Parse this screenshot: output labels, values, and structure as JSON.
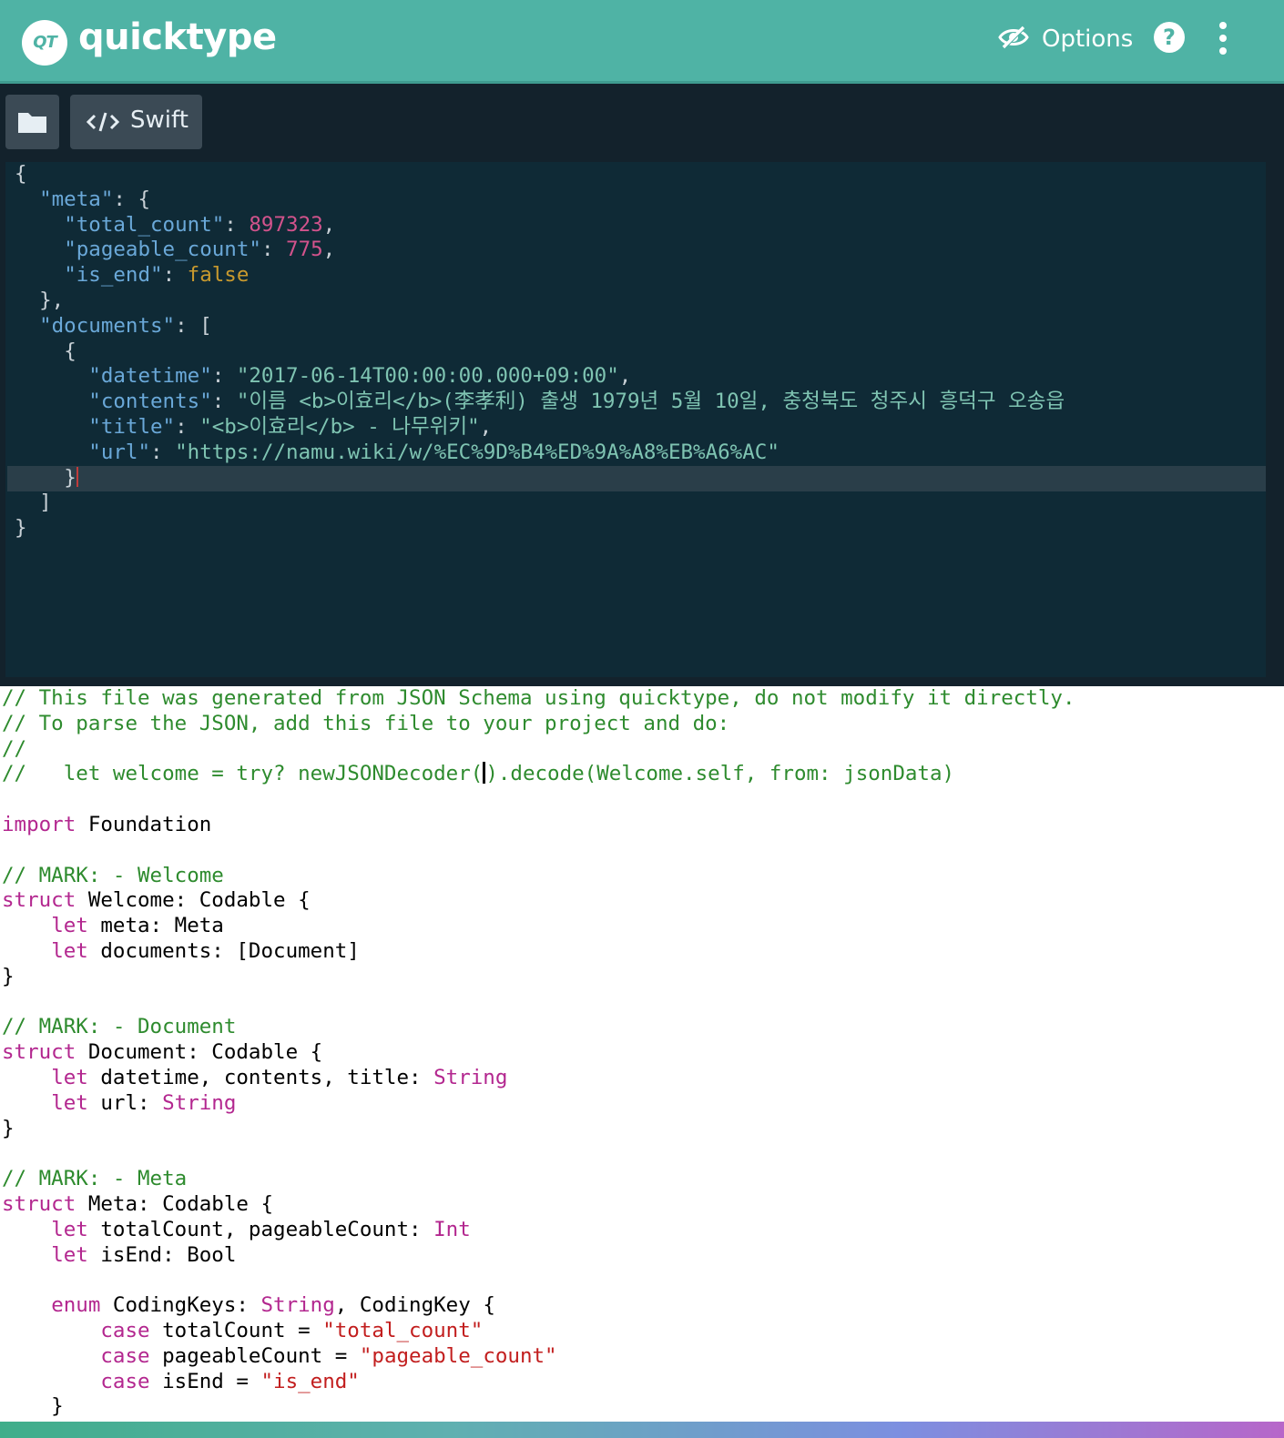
{
  "header": {
    "logo_text": "QT",
    "brand": "quicktype",
    "options_label": "Options",
    "help_label": "?"
  },
  "toolbar": {
    "language_label": "Swift"
  },
  "colors": {
    "header_bg": "#4fb3a5",
    "input_bg": "#13222c",
    "editor_bg": "#0f2a36",
    "output_bg": "#ffffff"
  },
  "input_json": {
    "l1": "{",
    "meta_key": "\"meta\"",
    "total_count_key": "\"total_count\"",
    "total_count_val": "897323",
    "pageable_count_key": "\"pageable_count\"",
    "pageable_count_val": "775",
    "is_end_key": "\"is_end\"",
    "is_end_val": "false",
    "meta_close": "},",
    "documents_key": "\"documents\"",
    "doc_open": "{",
    "datetime_key": "\"datetime\"",
    "datetime_val": "\"2017-06-14T00:00:00.000+09:00\"",
    "contents_key": "\"contents\"",
    "contents_val": "\"이름 <b>이효리</b>(李孝利) 출생 1979년 5월 10일, 충청북도 청주시 흥덕구 오송읍",
    "title_key": "\"title\"",
    "title_val": "\"<b>이효리</b> - 나무위키\"",
    "url_key": "\"url\"",
    "url_val": "\"https://namu.wiki/w/%EC%9D%B4%ED%9A%A8%EB%A6%AC\"",
    "doc_close": "}",
    "arr_close": "]",
    "root_close": "}"
  },
  "output_swift": {
    "c1": "// This file was generated from JSON Schema using quicktype, do not modify it directly.",
    "c2": "// To parse the JSON, add this file to your project and do:",
    "c3": "//",
    "c4a": "//   let welcome = try? newJSONDecoder(",
    "c4b": ").decode(Welcome.self, from: jsonData)",
    "import_kw": "import",
    "import_mod": " Foundation",
    "mark_welcome": "// MARK: - Welcome",
    "struct_kw": "struct",
    "welcome_decl": " Welcome: Codable {",
    "let_kw": "let",
    "welcome_meta": " meta: Meta",
    "welcome_docs": " documents: [Document]",
    "close_brace": "}",
    "mark_document": "// MARK: - Document",
    "document_decl": " Document: Codable {",
    "doc_fields1": " datetime, contents, title: ",
    "string_type": "String",
    "doc_fields2": " url: ",
    "mark_meta": "// MARK: - Meta",
    "meta_decl": " Meta: Codable {",
    "meta_fields1": " totalCount, pageableCount: ",
    "int_type": "Int",
    "meta_fields2": " isEnd: Bool",
    "enum_kw": "enum",
    "enum_decl1": " CodingKeys: ",
    "enum_decl2": ", CodingKey {",
    "case_kw": "case",
    "case1_name": " totalCount = ",
    "case1_val": "\"total_count\"",
    "case2_name": " pageableCount = ",
    "case2_val": "\"pageable_count\"",
    "case3_name": " isEnd = ",
    "case3_val": "\"is_end\"",
    "enum_close": "    }"
  }
}
